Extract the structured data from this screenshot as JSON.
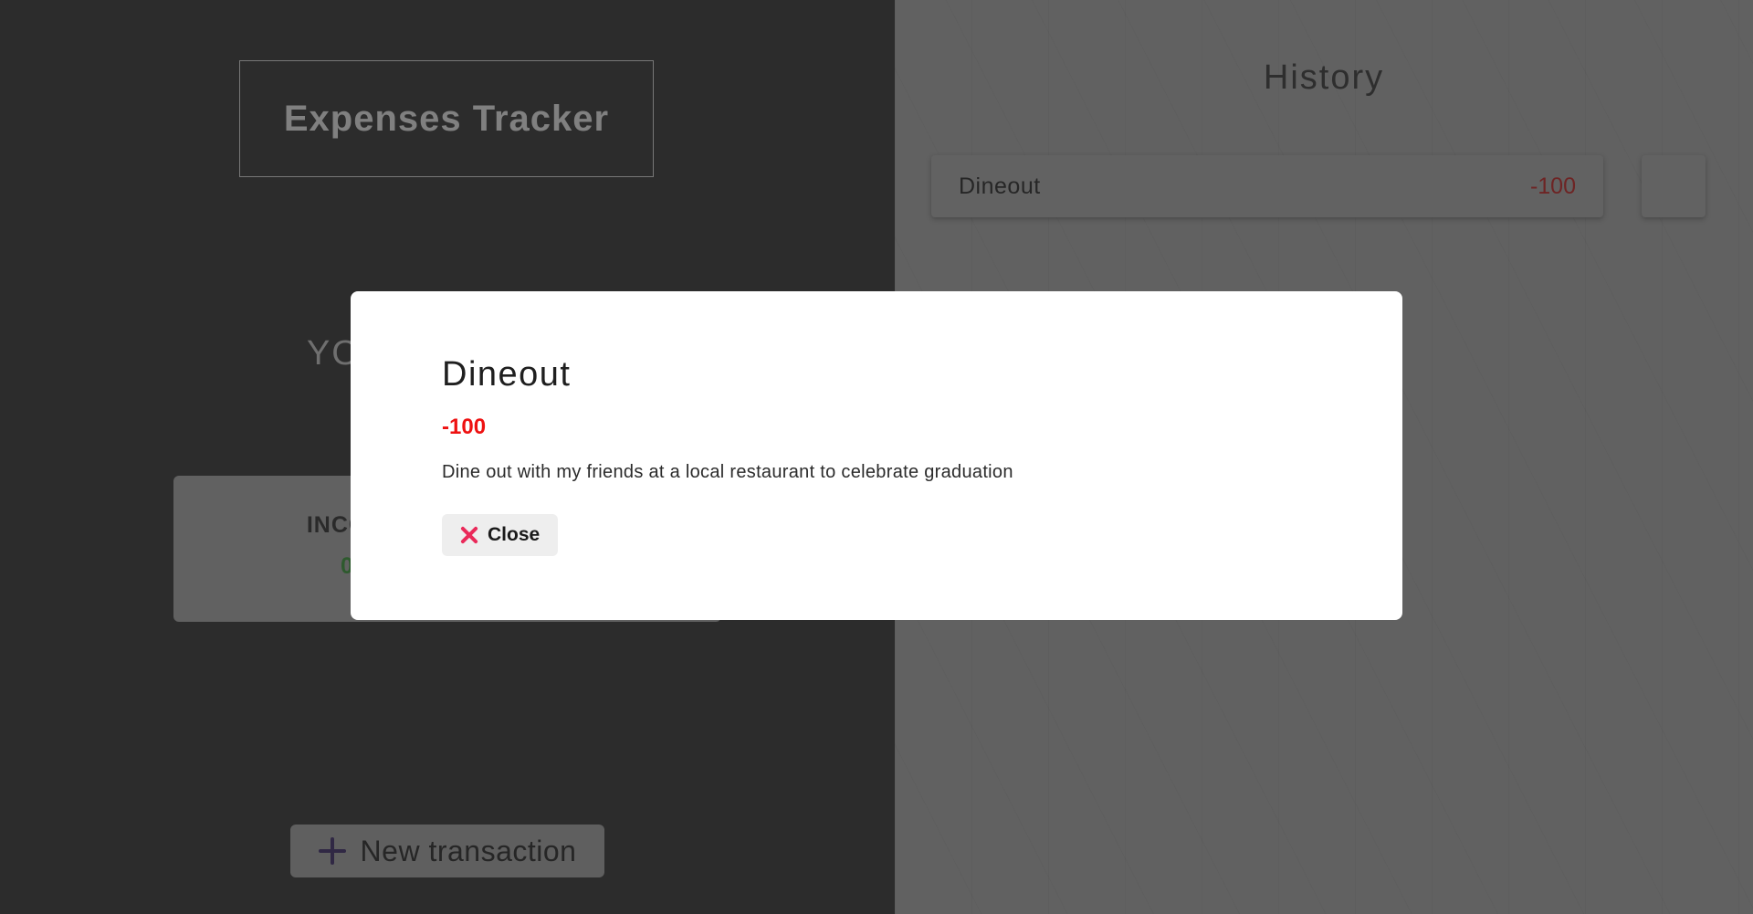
{
  "app": {
    "title": "Expenses Tracker",
    "balance_label_partial": "YO"
  },
  "summary": {
    "income_label_partial": "INCOM",
    "income_value": "0",
    "income_color": "#2e5a2e"
  },
  "actions": {
    "new_transaction_label": "New transaction",
    "new_transaction_icon": "plus-icon"
  },
  "history": {
    "title": "History",
    "items": [
      {
        "name": "Dineout",
        "amount": "-100",
        "amount_color": "#6e2424"
      }
    ]
  },
  "modal": {
    "title": "Dineout",
    "amount": "-100",
    "amount_color": "#ee1111",
    "description": "Dine out with my friends at a local restaurant to celebrate graduation",
    "close_label": "Close",
    "close_icon": "close-icon",
    "close_icon_color": "#ea2a5a"
  }
}
